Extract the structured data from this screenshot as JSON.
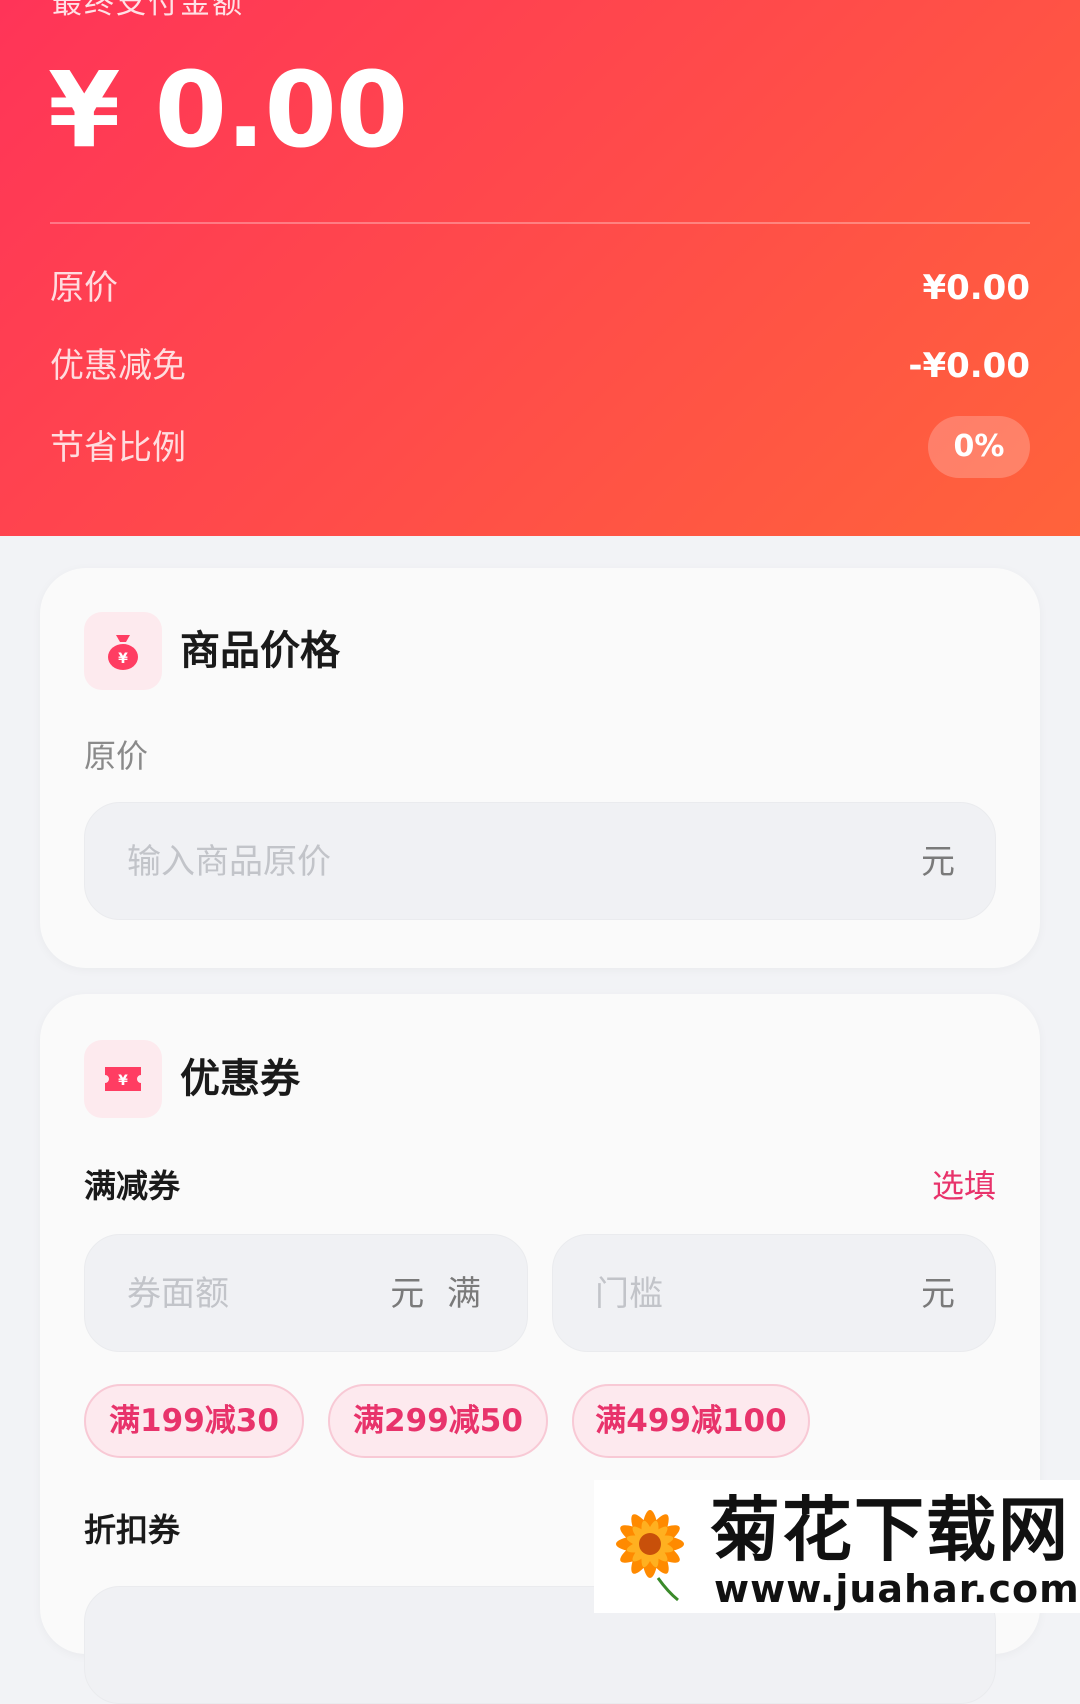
{
  "header": {
    "title_cut": "最终支付金额",
    "total": "¥ 0.00",
    "rows": [
      {
        "label": "原价",
        "value": "¥0.00"
      },
      {
        "label": "优惠减免",
        "value": "-¥0.00"
      },
      {
        "label": "节省比例",
        "value": "0%"
      }
    ]
  },
  "price_card": {
    "title": "商品价格",
    "field_label": "原价",
    "input_placeholder": "输入商品原价",
    "unit": "元"
  },
  "coupon_card": {
    "title": "优惠券",
    "full_reduction": {
      "label": "满减券",
      "hint": "选填",
      "amount_placeholder": "券面额",
      "amount_unit": "元 满",
      "threshold_placeholder": "门槛",
      "threshold_unit": "元",
      "chips": [
        "满199减30",
        "满299减50",
        "满499减100"
      ]
    },
    "discount_label": "折扣券"
  },
  "watermark": {
    "brand": "菊花下载网",
    "url": "www.juahar.com"
  },
  "colors": {
    "accent": "#e8336b",
    "header_start": "#ff3458",
    "header_end": "#ff633b"
  }
}
